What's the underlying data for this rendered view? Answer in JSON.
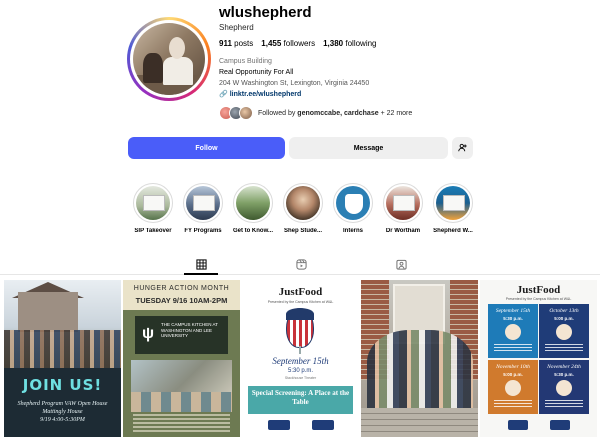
{
  "profile": {
    "username": "wlushepherd",
    "more_icon": "ellipsis-icon",
    "full_name": "Shepherd",
    "stats": {
      "posts_count": "911",
      "posts_label": "posts",
      "followers_count": "1,455",
      "followers_label": "followers",
      "following_count": "1,380",
      "following_label": "following"
    },
    "category": "Campus Building",
    "bio": "Real Opportunity For All",
    "address": "204 W Washington St, Lexington, Virginia 24450",
    "link": "linktr.ee/wlushepherd",
    "link_icon": "link-icon",
    "followed_by_prefix": "Followed by ",
    "followed_by_names": "genomccabe, cardchase",
    "followed_by_suffix": " + 22 more"
  },
  "actions": {
    "follow_label": "Follow",
    "message_label": "Message",
    "suggest_icon": "add-person-icon"
  },
  "highlights": [
    {
      "label": "SIP Takeover"
    },
    {
      "label": "FY Programs"
    },
    {
      "label": "Get to Know..."
    },
    {
      "label": "Shep Stude..."
    },
    {
      "label": "Interns"
    },
    {
      "label": "Dr Wortham"
    },
    {
      "label": "Shepherd W..."
    }
  ],
  "tabs": {
    "posts_icon": "grid-icon",
    "reels_icon": "reels-icon",
    "tagged_icon": "tagged-icon",
    "active": "posts"
  },
  "posts": {
    "post1": {
      "headline": "JOIN US!",
      "caption_line1": "Shepherd Program VAW Open House",
      "caption_line2": "Mattingly House",
      "caption_line3": "9/19 4:00-5:30PM"
    },
    "post2": {
      "title": "HUNGER ACTION MONTH",
      "date": "TUESDAY 9/16 10AM-2PM",
      "logo_text": "THE CAMPUS KITCHEN AT WASHINGTON AND LEE UNIVERSITY"
    },
    "post3": {
      "brand": "JustFood",
      "subtitle": "Presented by the Campus Kitchen at W&L",
      "date": "September 15th",
      "time": "5:30 p.m.",
      "venue": "Stackhouse Theater",
      "box_text": "Special Screening: A Place at the Table"
    },
    "post5": {
      "brand": "JustFood",
      "subtitle": "Presented by the Campus Kitchen at W&L",
      "c1_date": "September 15th",
      "c1_time": "5:30 p.m.",
      "c2_date": "October 13th",
      "c2_time": "5:00 p.m.",
      "c3_date": "November 10th",
      "c3_time": "5:00 p.m.",
      "c4_date": "November 24th",
      "c4_time": "5:30 p.m."
    }
  },
  "colors": {
    "follow_button": "#4a5df9",
    "link": "#00376b",
    "secondary_button": "#efefef"
  }
}
